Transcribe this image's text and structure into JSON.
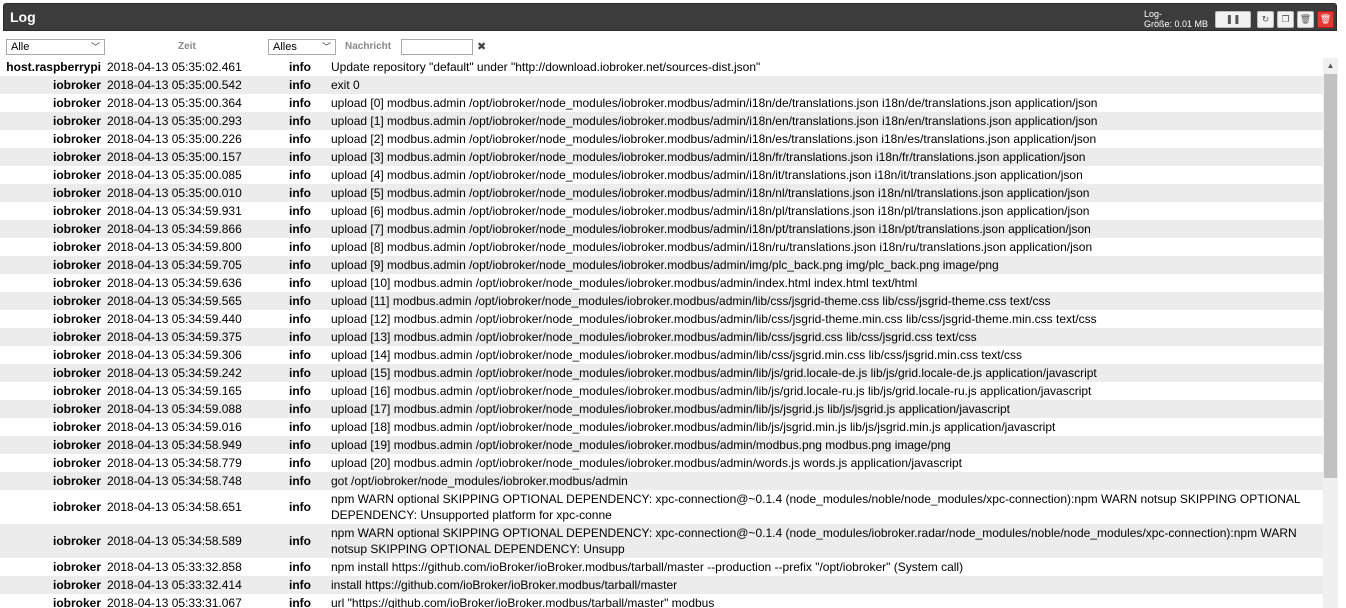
{
  "header": {
    "title": "Log",
    "size_label_line1": "Log-",
    "size_label_line2": "Größe: 0.01 MB",
    "buttons": [
      "pause-icon",
      "refresh-icon",
      "copy-icon",
      "trash-icon",
      "delete-red-icon"
    ]
  },
  "filters": {
    "source_select": "Alle",
    "time_label": "Zeit",
    "severity_select": "Alles",
    "message_label": "Nachricht",
    "message_value": "",
    "clear_symbol": "✖"
  },
  "rows": [
    {
      "source": "host.raspberrypi",
      "time": "2018-04-13 05:35:02.461",
      "severity": "info",
      "message": "Update repository \"default\" under \"http://download.iobroker.net/sources-dist.json\""
    },
    {
      "source": "iobroker",
      "time": "2018-04-13 05:35:00.542",
      "severity": "info",
      "message": "exit 0"
    },
    {
      "source": "iobroker",
      "time": "2018-04-13 05:35:00.364",
      "severity": "info",
      "message": "upload [0] modbus.admin /opt/iobroker/node_modules/iobroker.modbus/admin/i18n/de/translations.json i18n/de/translations.json application/json"
    },
    {
      "source": "iobroker",
      "time": "2018-04-13 05:35:00.293",
      "severity": "info",
      "message": "upload [1] modbus.admin /opt/iobroker/node_modules/iobroker.modbus/admin/i18n/en/translations.json i18n/en/translations.json application/json"
    },
    {
      "source": "iobroker",
      "time": "2018-04-13 05:35:00.226",
      "severity": "info",
      "message": "upload [2] modbus.admin /opt/iobroker/node_modules/iobroker.modbus/admin/i18n/es/translations.json i18n/es/translations.json application/json"
    },
    {
      "source": "iobroker",
      "time": "2018-04-13 05:35:00.157",
      "severity": "info",
      "message": "upload [3] modbus.admin /opt/iobroker/node_modules/iobroker.modbus/admin/i18n/fr/translations.json i18n/fr/translations.json application/json"
    },
    {
      "source": "iobroker",
      "time": "2018-04-13 05:35:00.085",
      "severity": "info",
      "message": "upload [4] modbus.admin /opt/iobroker/node_modules/iobroker.modbus/admin/i18n/it/translations.json i18n/it/translations.json application/json"
    },
    {
      "source": "iobroker",
      "time": "2018-04-13 05:35:00.010",
      "severity": "info",
      "message": "upload [5] modbus.admin /opt/iobroker/node_modules/iobroker.modbus/admin/i18n/nl/translations.json i18n/nl/translations.json application/json"
    },
    {
      "source": "iobroker",
      "time": "2018-04-13 05:34:59.931",
      "severity": "info",
      "message": "upload [6] modbus.admin /opt/iobroker/node_modules/iobroker.modbus/admin/i18n/pl/translations.json i18n/pl/translations.json application/json"
    },
    {
      "source": "iobroker",
      "time": "2018-04-13 05:34:59.866",
      "severity": "info",
      "message": "upload [7] modbus.admin /opt/iobroker/node_modules/iobroker.modbus/admin/i18n/pt/translations.json i18n/pt/translations.json application/json"
    },
    {
      "source": "iobroker",
      "time": "2018-04-13 05:34:59.800",
      "severity": "info",
      "message": "upload [8] modbus.admin /opt/iobroker/node_modules/iobroker.modbus/admin/i18n/ru/translations.json i18n/ru/translations.json application/json"
    },
    {
      "source": "iobroker",
      "time": "2018-04-13 05:34:59.705",
      "severity": "info",
      "message": "upload [9] modbus.admin /opt/iobroker/node_modules/iobroker.modbus/admin/img/plc_back.png img/plc_back.png image/png"
    },
    {
      "source": "iobroker",
      "time": "2018-04-13 05:34:59.636",
      "severity": "info",
      "message": "upload [10] modbus.admin /opt/iobroker/node_modules/iobroker.modbus/admin/index.html index.html text/html"
    },
    {
      "source": "iobroker",
      "time": "2018-04-13 05:34:59.565",
      "severity": "info",
      "message": "upload [11] modbus.admin /opt/iobroker/node_modules/iobroker.modbus/admin/lib/css/jsgrid-theme.css lib/css/jsgrid-theme.css text/css"
    },
    {
      "source": "iobroker",
      "time": "2018-04-13 05:34:59.440",
      "severity": "info",
      "message": "upload [12] modbus.admin /opt/iobroker/node_modules/iobroker.modbus/admin/lib/css/jsgrid-theme.min.css lib/css/jsgrid-theme.min.css text/css"
    },
    {
      "source": "iobroker",
      "time": "2018-04-13 05:34:59.375",
      "severity": "info",
      "message": "upload [13] modbus.admin /opt/iobroker/node_modules/iobroker.modbus/admin/lib/css/jsgrid.css lib/css/jsgrid.css text/css"
    },
    {
      "source": "iobroker",
      "time": "2018-04-13 05:34:59.306",
      "severity": "info",
      "message": "upload [14] modbus.admin /opt/iobroker/node_modules/iobroker.modbus/admin/lib/css/jsgrid.min.css lib/css/jsgrid.min.css text/css"
    },
    {
      "source": "iobroker",
      "time": "2018-04-13 05:34:59.242",
      "severity": "info",
      "message": "upload [15] modbus.admin /opt/iobroker/node_modules/iobroker.modbus/admin/lib/js/grid.locale-de.js lib/js/grid.locale-de.js application/javascript"
    },
    {
      "source": "iobroker",
      "time": "2018-04-13 05:34:59.165",
      "severity": "info",
      "message": "upload [16] modbus.admin /opt/iobroker/node_modules/iobroker.modbus/admin/lib/js/grid.locale-ru.js lib/js/grid.locale-ru.js application/javascript"
    },
    {
      "source": "iobroker",
      "time": "2018-04-13 05:34:59.088",
      "severity": "info",
      "message": "upload [17] modbus.admin /opt/iobroker/node_modules/iobroker.modbus/admin/lib/js/jsgrid.js lib/js/jsgrid.js application/javascript"
    },
    {
      "source": "iobroker",
      "time": "2018-04-13 05:34:59.016",
      "severity": "info",
      "message": "upload [18] modbus.admin /opt/iobroker/node_modules/iobroker.modbus/admin/lib/js/jsgrid.min.js lib/js/jsgrid.min.js application/javascript"
    },
    {
      "source": "iobroker",
      "time": "2018-04-13 05:34:58.949",
      "severity": "info",
      "message": "upload [19] modbus.admin /opt/iobroker/node_modules/iobroker.modbus/admin/modbus.png modbus.png image/png"
    },
    {
      "source": "iobroker",
      "time": "2018-04-13 05:34:58.779",
      "severity": "info",
      "message": "upload [20] modbus.admin /opt/iobroker/node_modules/iobroker.modbus/admin/words.js words.js application/javascript"
    },
    {
      "source": "iobroker",
      "time": "2018-04-13 05:34:58.748",
      "severity": "info",
      "message": "got /opt/iobroker/node_modules/iobroker.modbus/admin"
    },
    {
      "source": "iobroker",
      "time": "2018-04-13 05:34:58.651",
      "severity": "info",
      "message": "npm WARN optional SKIPPING OPTIONAL DEPENDENCY: xpc-connection@~0.1.4 (node_modules/noble/node_modules/xpc-connection):npm WARN notsup SKIPPING OPTIONAL DEPENDENCY: Unsupported platform for xpc-conne",
      "tall": true
    },
    {
      "source": "iobroker",
      "time": "2018-04-13 05:34:58.589",
      "severity": "info",
      "message": "npm WARN optional SKIPPING OPTIONAL DEPENDENCY: xpc-connection@~0.1.4 (node_modules/iobroker.radar/node_modules/noble/node_modules/xpc-connection):npm WARN notsup SKIPPING OPTIONAL DEPENDENCY: Unsupp",
      "tall": true
    },
    {
      "source": "iobroker",
      "time": "2018-04-13 05:33:32.858",
      "severity": "info",
      "message": "npm install https://github.com/ioBroker/ioBroker.modbus/tarball/master --production --prefix \"/opt/iobroker\" (System call)"
    },
    {
      "source": "iobroker",
      "time": "2018-04-13 05:33:32.414",
      "severity": "info",
      "message": "install https://github.com/ioBroker/ioBroker.modbus/tarball/master"
    },
    {
      "source": "iobroker",
      "time": "2018-04-13 05:33:31.067",
      "severity": "info",
      "message": "url \"https://github.com/ioBroker/ioBroker.modbus/tarball/master\" modbus"
    }
  ]
}
